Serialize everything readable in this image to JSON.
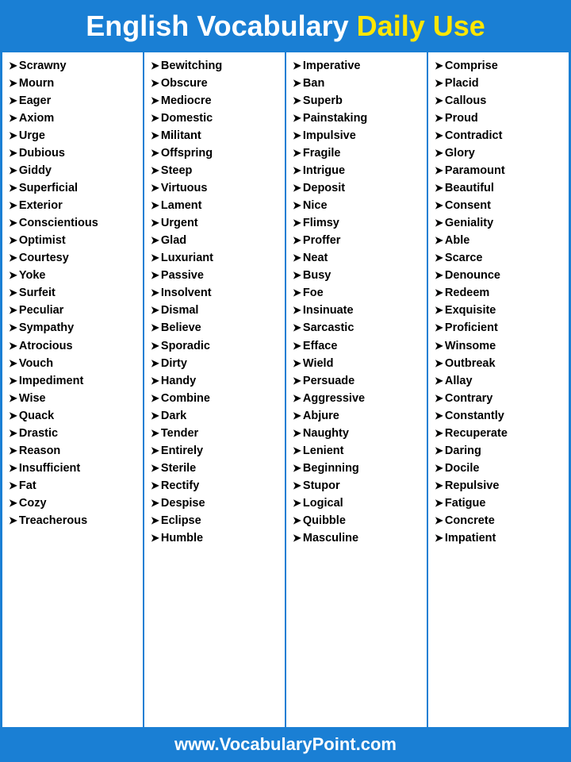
{
  "header": {
    "title_white": "English Vocabulary",
    "title_yellow": "Daily Use"
  },
  "footer": {
    "url": "www.VocabularyPoint.com"
  },
  "columns": [
    {
      "words": [
        "Scrawny",
        "Mourn",
        "Eager",
        "Axiom",
        "Urge",
        "Dubious",
        "Giddy",
        "Superficial",
        "Exterior",
        "Conscientious",
        "Optimist",
        "Courtesy",
        "Yoke",
        "Surfeit",
        "Peculiar",
        "Sympathy",
        "Atrocious",
        "Vouch",
        "Impediment",
        "Wise",
        "Quack",
        "Drastic",
        "Reason",
        "Insufficient",
        "Fat",
        "Cozy",
        "Treacherous"
      ]
    },
    {
      "words": [
        "Bewitching",
        "Obscure",
        "Mediocre",
        "Domestic",
        "Militant",
        "Offspring",
        "Steep",
        "Virtuous",
        "Lament",
        "Urgent",
        "Glad",
        "Luxuriant",
        "Passive",
        "Insolvent",
        "Dismal",
        "Believe",
        "Sporadic",
        "Dirty",
        "Handy",
        "Combine",
        "Dark",
        "Tender",
        "Entirely",
        "Sterile",
        "Rectify",
        "Despise",
        "Eclipse",
        "Humble"
      ]
    },
    {
      "words": [
        "Imperative",
        "Ban",
        "Superb",
        "Painstaking",
        "Impulsive",
        "Fragile",
        "Intrigue",
        "Deposit",
        "Nice",
        "Flimsy",
        "Proffer",
        "Neat",
        "Busy",
        "Foe",
        "Insinuate",
        "Sarcastic",
        "Efface",
        "Wield",
        "Persuade",
        "Aggressive",
        "Abjure",
        "Naughty",
        "Lenient",
        "Beginning",
        "Stupor",
        "Logical",
        "Quibble",
        "Masculine"
      ]
    },
    {
      "words": [
        "Comprise",
        "Placid",
        "Callous",
        "Proud",
        "Contradict",
        "Glory",
        "Paramount",
        "Beautiful",
        "Consent",
        "Geniality",
        "Able",
        "Scarce",
        "Denounce",
        "Redeem",
        "Exquisite",
        "Proficient",
        "Winsome",
        "Outbreak",
        "Allay",
        "Contrary",
        "Constantly",
        "Recuperate",
        "Daring",
        "Docile",
        "Repulsive",
        "Fatigue",
        "Concrete",
        "Impatient"
      ]
    }
  ]
}
